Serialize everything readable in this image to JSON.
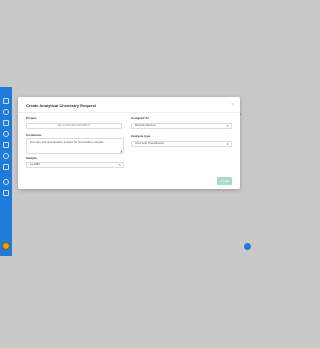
{
  "modal": {
    "title": "Create Analytical Chemistry Request",
    "close_glyph": "×"
  },
  "form": {
    "project_label": "Project",
    "project_button": "RE-CHOOSE PROJECT",
    "comments_label": "Comments",
    "comments_value": "Run Hop acid quantification analysis for fermentation samples",
    "sample_label": "Sample",
    "sample_value": "ca-4896",
    "assigned_label": "Assigned To",
    "assigned_value": "Michelle Martinez",
    "analysis_label": "Analysis type",
    "analysis_value": "Hops Acid Quantification",
    "submit_label": "Create"
  },
  "background": {
    "right_text_1": "ject te",
    "right_text_2": "s (2)"
  },
  "colors": {
    "sidebar": "#1f7bd9",
    "submit": "#a6dcc4",
    "overlay": "#c9c9c9"
  },
  "icons": {
    "sidebar": [
      "home-icon",
      "list-icon",
      "flask-icon",
      "chart-icon",
      "users-icon",
      "gear-icon",
      "doc-icon",
      "bell-icon",
      "help-icon"
    ],
    "edit": "pencil-icon",
    "dropdown": "select-arrow-icon"
  }
}
